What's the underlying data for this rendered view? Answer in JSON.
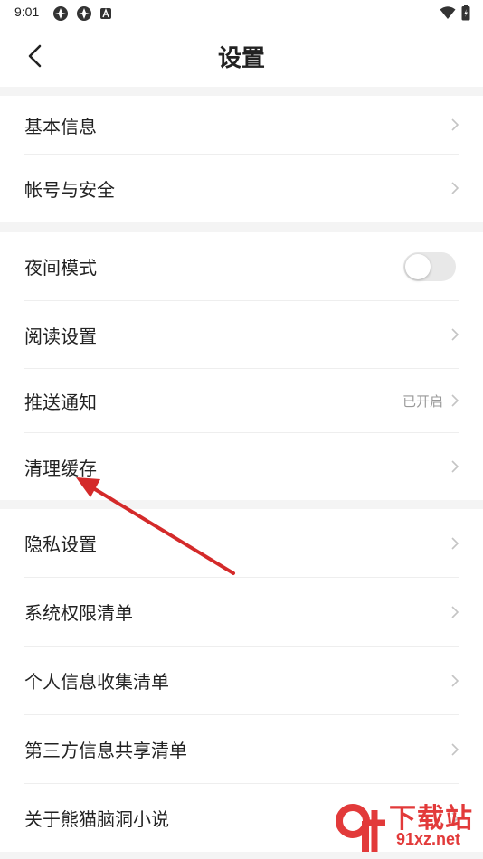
{
  "status_bar": {
    "time": "9:01",
    "left_icons": [
      "app-notification-icon",
      "app-notification-icon",
      "a-badge-icon"
    ],
    "right_icons": [
      "wifi-icon",
      "battery-icon"
    ]
  },
  "header": {
    "title": "设置",
    "back_icon": "back-chevron-icon"
  },
  "groups": [
    {
      "items": [
        {
          "label": "基本信息",
          "type": "link"
        },
        {
          "label": "帐号与安全",
          "type": "link"
        }
      ]
    },
    {
      "items": [
        {
          "label": "夜间模式",
          "type": "toggle",
          "on": false
        },
        {
          "label": "阅读设置",
          "type": "link"
        },
        {
          "label": "推送通知",
          "type": "link",
          "value": "已开启"
        },
        {
          "label": "清理缓存",
          "type": "link"
        }
      ]
    },
    {
      "items": [
        {
          "label": "隐私设置",
          "type": "link"
        },
        {
          "label": "系统权限清单",
          "type": "link"
        },
        {
          "label": "个人信息收集清单",
          "type": "link"
        },
        {
          "label": "第三方信息共享清单",
          "type": "link"
        },
        {
          "label": "关于熊猫脑洞小说",
          "type": "link"
        }
      ]
    }
  ],
  "annotation": {
    "type": "red-arrow",
    "points_to": "清理缓存",
    "color": "#d42a2a"
  },
  "watermark": {
    "logo_text": "9f",
    "title": "下载站",
    "subtitle": "91xz.net",
    "color": "#e23a3a"
  },
  "colors": {
    "background": "#ffffff",
    "section_gap": "#f4f4f4",
    "text_primary": "#222222",
    "text_secondary": "#999999",
    "chevron": "#c4c4c4",
    "toggle_off": "#e8e8e8"
  }
}
